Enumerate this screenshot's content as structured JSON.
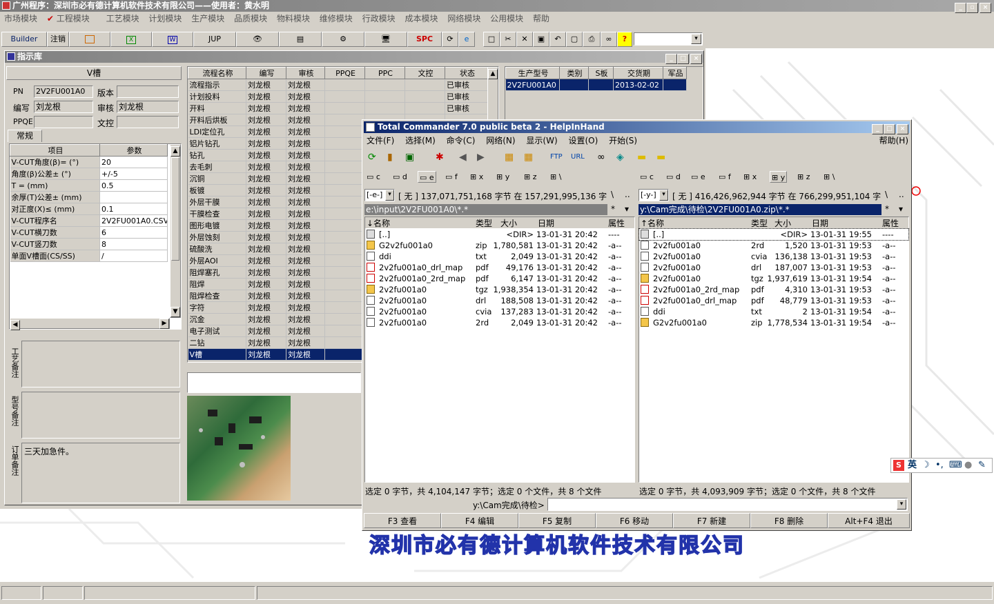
{
  "app": {
    "title": "广州程序：深圳市必有德计算机软件技术有限公司——使用者：黄水明",
    "menu": [
      "市场模块",
      "工程模块",
      "工艺模块",
      "计划模块",
      "生产模块",
      "品质模块",
      "物料模块",
      "维修模块",
      "行政模块",
      "成本模块",
      "网络模块",
      "公用模块",
      "帮助"
    ],
    "toolbar": {
      "builder": "Builder",
      "logout": "注销",
      "jup": "JUP",
      "spc": "SPC"
    },
    "watermark": "深圳市必有德计算机软件技术有限公司"
  },
  "library": {
    "title": "指示库",
    "process_name": "V槽",
    "fields": {
      "pn_label": "PN",
      "pn_value": "2V2FU001A0",
      "version_label": "版本",
      "version_value": "",
      "author_label": "编写",
      "author_value": "刘龙根",
      "reviewer_label": "审核",
      "reviewer_value": "刘龙根",
      "ppqe_label": "PPQE",
      "ppqe_value": "",
      "wenkong_label": "文控",
      "wenkong_value": ""
    },
    "tab": "常规",
    "param_headers": [
      "项目",
      "参数"
    ],
    "params": [
      [
        "V-CUT角度(β)= (°)",
        "20"
      ],
      [
        "角度(β)公差± (°)",
        "+/-5"
      ],
      [
        "T = (mm)",
        "0.5"
      ],
      [
        "余厚(T)公差± (mm)",
        ""
      ],
      [
        "对正度(X)≤ (mm)",
        "0.1"
      ],
      [
        "V-CUT程序名",
        "2V2FU001A0.CSV"
      ],
      [
        "V-CUT横刀数",
        "6"
      ],
      [
        "V-CUT竖刀数",
        "8"
      ],
      [
        "单面V槽面(CS/SS)",
        "/"
      ]
    ],
    "note_labels": {
      "process": "工艺备注",
      "model": "型号备注",
      "order": "订单备注"
    },
    "order_note": "三天加急件。",
    "flow_headers": [
      "流程名称",
      "编写",
      "审核",
      "PPQE",
      "PPC",
      "文控",
      "状态"
    ],
    "flow_rows": [
      [
        "流程指示",
        "刘龙根",
        "刘龙根",
        "",
        "",
        "",
        "已审核"
      ],
      [
        "计划投料",
        "刘龙根",
        "刘龙根",
        "",
        "",
        "",
        "已审核"
      ],
      [
        "开料",
        "刘龙根",
        "刘龙根",
        "",
        "",
        "",
        "已审核"
      ],
      [
        "开料后烘板",
        "刘龙根",
        "刘龙根",
        "",
        "",
        "",
        ""
      ],
      [
        "LDI定位孔",
        "刘龙根",
        "刘龙根",
        "",
        "",
        "",
        ""
      ],
      [
        "铝片钻孔",
        "刘龙根",
        "刘龙根",
        "",
        "",
        "",
        ""
      ],
      [
        "钻孔",
        "刘龙根",
        "刘龙根",
        "",
        "",
        "",
        ""
      ],
      [
        "去毛刺",
        "刘龙根",
        "刘龙根",
        "",
        "",
        "",
        ""
      ],
      [
        "沉铜",
        "刘龙根",
        "刘龙根",
        "",
        "",
        "",
        ""
      ],
      [
        "板镀",
        "刘龙根",
        "刘龙根",
        "",
        "",
        "",
        ""
      ],
      [
        "外层干膜",
        "刘龙根",
        "刘龙根",
        "",
        "",
        "",
        ""
      ],
      [
        "干膜检查",
        "刘龙根",
        "刘龙根",
        "",
        "",
        "",
        ""
      ],
      [
        "图形电镀",
        "刘龙根",
        "刘龙根",
        "",
        "",
        "",
        ""
      ],
      [
        "外层蚀刻",
        "刘龙根",
        "刘龙根",
        "",
        "",
        "",
        ""
      ],
      [
        "硫酸洗",
        "刘龙根",
        "刘龙根",
        "",
        "",
        "",
        ""
      ],
      [
        "外层AOI",
        "刘龙根",
        "刘龙根",
        "",
        "",
        "",
        ""
      ],
      [
        "阻焊塞孔",
        "刘龙根",
        "刘龙根",
        "",
        "",
        "",
        ""
      ],
      [
        "阻焊",
        "刘龙根",
        "刘龙根",
        "",
        "",
        "",
        ""
      ],
      [
        "阻焊检查",
        "刘龙根",
        "刘龙根",
        "",
        "",
        "",
        ""
      ],
      [
        "字符",
        "刘龙根",
        "刘龙根",
        "",
        "",
        "",
        ""
      ],
      [
        "沉金",
        "刘龙根",
        "刘龙根",
        "",
        "",
        "",
        ""
      ],
      [
        "电子测试",
        "刘龙根",
        "刘龙根",
        "",
        "",
        "",
        ""
      ],
      [
        "二钻",
        "刘龙根",
        "刘龙根",
        "",
        "",
        "",
        ""
      ],
      [
        "V槽",
        "刘龙根",
        "刘龙根",
        "",
        "",
        "",
        ""
      ]
    ],
    "prod_headers": [
      "生产型号",
      "类别",
      "S板",
      "交货期",
      "军品"
    ],
    "prod_rows": [
      [
        "2V2FU001A0",
        "",
        "",
        "2013-02-02",
        ""
      ]
    ]
  },
  "tc": {
    "title": "Total Commander 7.0 public beta 2 - HelpInHand",
    "menu": [
      "文件(F)",
      "选择(M)",
      "命令(C)",
      "网络(N)",
      "显示(W)",
      "设置(O)",
      "开始(S)"
    ],
    "help": "帮助(H)",
    "drives": [
      "c",
      "d",
      "e",
      "f",
      "x",
      "y",
      "z",
      "\\"
    ],
    "left": {
      "drive": "[-e-]",
      "info": "[ 无 ]  137,071,751,168 字节 在 157,291,995,136 字节",
      "path": "e:\\input\\2V2FU001A0\\*.*",
      "headers": [
        "↓名称",
        "类型",
        "大小",
        "日期",
        "属性"
      ],
      "files": [
        [
          "[..]",
          "",
          "<DIR>",
          "13-01-31 20:42",
          "----",
          "up"
        ],
        [
          "G2v2fu001a0",
          "zip",
          "1,780,581",
          "13-01-31 20:42",
          "-a--",
          "zip"
        ],
        [
          "ddi",
          "txt",
          "2,049",
          "13-01-31 20:42",
          "-a--",
          "txt"
        ],
        [
          "2v2fu001a0_drl_map",
          "pdf",
          "49,176",
          "13-01-31 20:42",
          "-a--",
          "pdf"
        ],
        [
          "2v2fu001a0_2rd_map",
          "pdf",
          "6,147",
          "13-01-31 20:42",
          "-a--",
          "pdf"
        ],
        [
          "2v2fu001a0",
          "tgz",
          "1,938,354",
          "13-01-31 20:42",
          "-a--",
          "zip"
        ],
        [
          "2v2fu001a0",
          "drl",
          "188,508",
          "13-01-31 20:42",
          "-a--",
          "doc"
        ],
        [
          "2v2fu001a0",
          "cvia",
          "137,283",
          "13-01-31 20:42",
          "-a--",
          "doc"
        ],
        [
          "2v2fu001a0",
          "2rd",
          "2,049",
          "13-01-31 20:42",
          "-a--",
          "doc"
        ]
      ],
      "status": "选定 0 字节，共 4,104,147 字节；选定 0 个文件，共 8 个文件"
    },
    "right": {
      "drive": "[-y-]",
      "info": "[ 无 ]  416,426,962,944 字节 在 766,299,951,104 字节",
      "path": "y:\\Cam完成\\待检\\2V2FU001A0.zip\\*.*",
      "headers": [
        "↑名称",
        "类型",
        "大小",
        "日期",
        "属性"
      ],
      "files": [
        [
          "[..]",
          "",
          "<DIR>",
          "13-01-31 19:55",
          "----",
          "up"
        ],
        [
          "2v2fu001a0",
          "2rd",
          "1,520",
          "13-01-31 19:53",
          "-a--",
          "doc"
        ],
        [
          "2v2fu001a0",
          "cvia",
          "136,138",
          "13-01-31 19:53",
          "-a--",
          "doc"
        ],
        [
          "2v2fu001a0",
          "drl",
          "187,007",
          "13-01-31 19:53",
          "-a--",
          "doc"
        ],
        [
          "2v2fu001a0",
          "tgz",
          "1,937,619",
          "13-01-31 19:54",
          "-a--",
          "zip"
        ],
        [
          "2v2fu001a0_2rd_map",
          "pdf",
          "4,310",
          "13-01-31 19:53",
          "-a--",
          "pdf"
        ],
        [
          "2v2fu001a0_drl_map",
          "pdf",
          "48,779",
          "13-01-31 19:53",
          "-a--",
          "pdf"
        ],
        [
          "ddi",
          "txt",
          "2",
          "13-01-31 19:54",
          "-a--",
          "txt"
        ],
        [
          "G2v2fu001a0",
          "zip",
          "1,778,534",
          "13-01-31 19:54",
          "-a--",
          "zip"
        ]
      ],
      "status": "选定 0 字节，共 4,093,909 字节；选定 0 个文件，共 8 个文件"
    },
    "cmd_prompt": "y:\\Cam完成\\待检>",
    "fkeys": [
      "F3 查看",
      "F4 编辑",
      "F5 复制",
      "F6 移动",
      "F7 新建",
      "F8 删除",
      "Alt+F4 退出"
    ]
  },
  "ime": {
    "lang": "英"
  }
}
